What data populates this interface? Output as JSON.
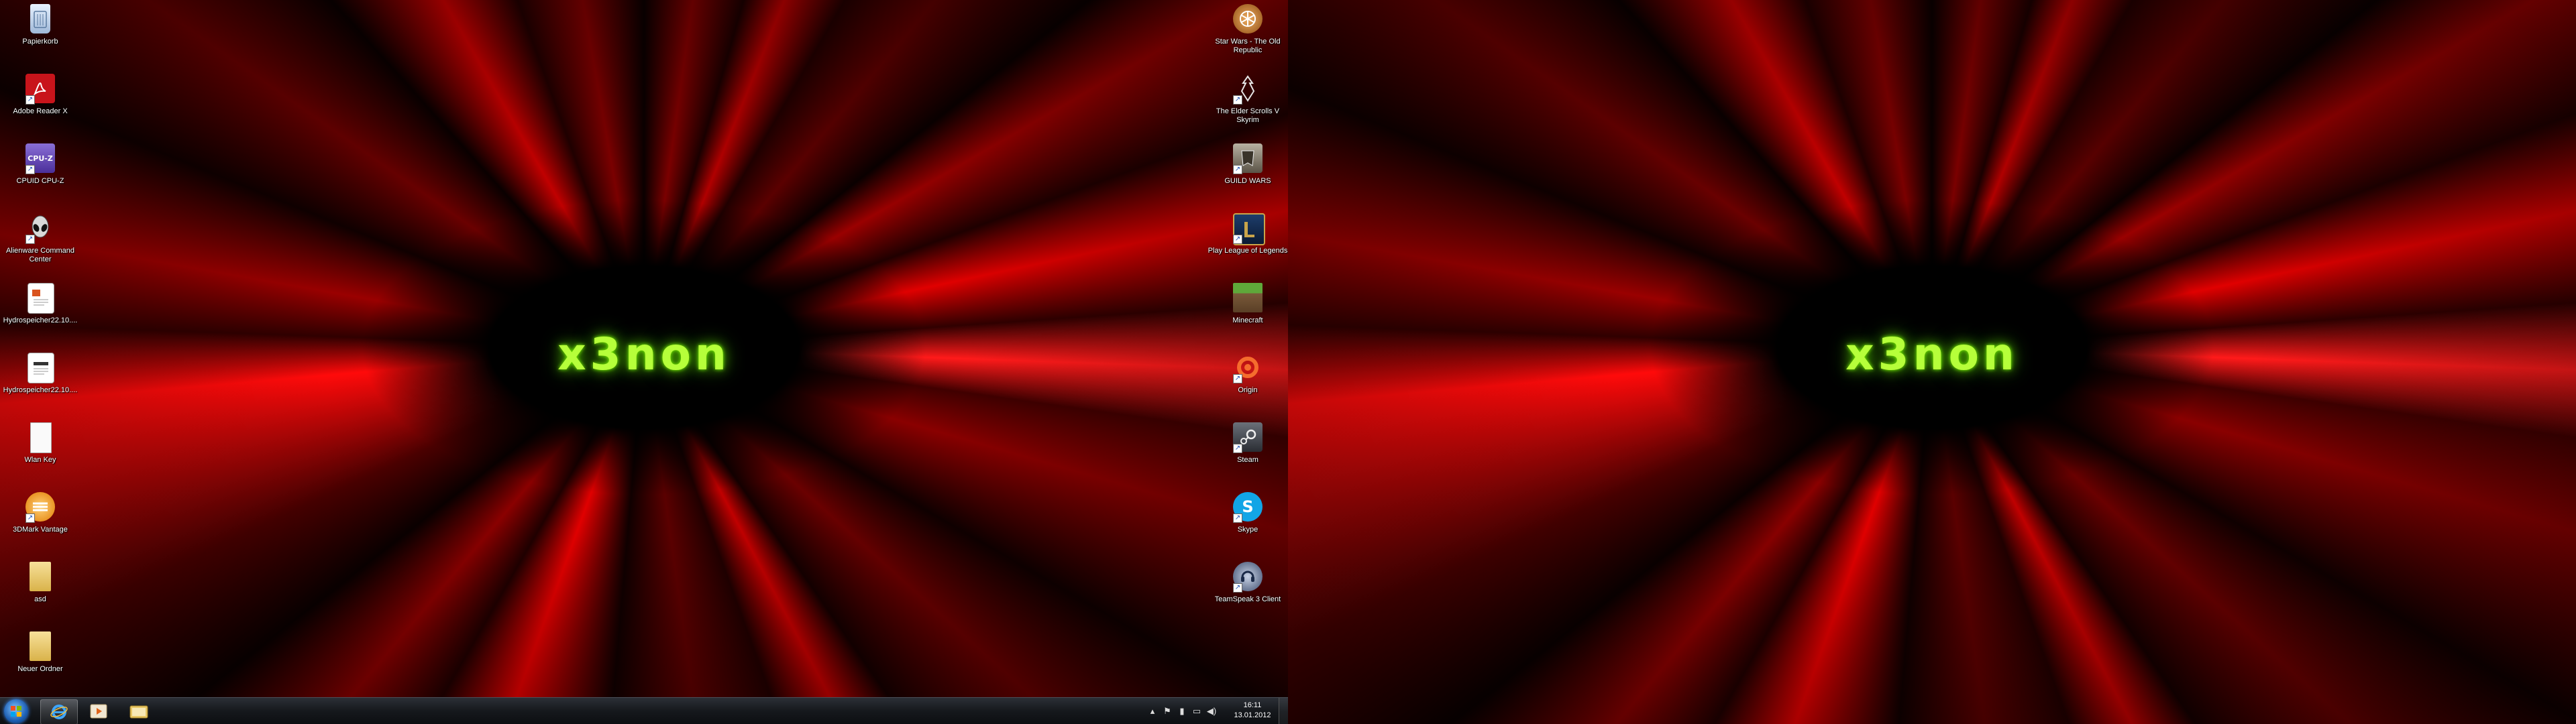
{
  "desktop": {
    "logo_text": "x3non",
    "left_icons": [
      {
        "name": "recycle-bin-icon",
        "label": "Papierkorb"
      },
      {
        "name": "adobe-reader-icon",
        "label": "Adobe Reader X"
      },
      {
        "name": "cpuz-icon",
        "label": "CPUID CPU-Z"
      },
      {
        "name": "alienware-icon",
        "label": "Alienware Command Center"
      },
      {
        "name": "document-icon",
        "label": "Hydrospeicher22.10...."
      },
      {
        "name": "document-icon",
        "label": "Hydrospeicher22.10...."
      },
      {
        "name": "text-file-icon",
        "label": "Wlan Key"
      },
      {
        "name": "3dmark-icon",
        "label": "3DMark Vantage"
      },
      {
        "name": "folder-icon",
        "label": "asd"
      },
      {
        "name": "folder-icon",
        "label": "Neuer Ordner"
      }
    ],
    "right_icons": [
      {
        "name": "star-wars-icon",
        "label": "Star Wars - The Old Republic"
      },
      {
        "name": "skyrim-icon",
        "label": "The Elder Scrolls V Skyrim"
      },
      {
        "name": "guild-wars-icon",
        "label": "GUILD WARS"
      },
      {
        "name": "league-of-legends-icon",
        "label": "Play League of Legends"
      },
      {
        "name": "minecraft-icon",
        "label": "Minecraft"
      },
      {
        "name": "origin-icon",
        "label": "Origin"
      },
      {
        "name": "steam-icon",
        "label": "Steam"
      },
      {
        "name": "skype-icon",
        "label": "Skype"
      },
      {
        "name": "teamspeak-icon",
        "label": "TeamSpeak 3 Client"
      }
    ]
  },
  "taskbar": {
    "time": "16:11",
    "date": "13.01.2012"
  },
  "colors": {
    "logo_green": "#b6ff3a",
    "wallpaper_red": "#e00000"
  }
}
